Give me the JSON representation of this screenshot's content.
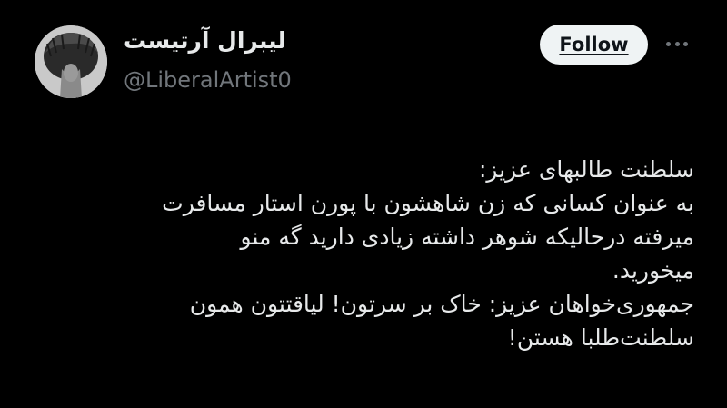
{
  "author": {
    "display_name": "لیبرال آرتیست",
    "handle": "@LiberalArtist0",
    "avatar_icon": "profile-photo-avatar"
  },
  "actions": {
    "follow_label": "Follow",
    "more_icon": "more-horizontal-icon"
  },
  "tweet": {
    "lines": [
      "سلطنت طالبهای عزیز:",
      "به عنوان کسانی که زن شاهشون با پورن استار مسافرت",
      "میرفته درحالیکه شوهر داشته زیادی دارید گه منو",
      "میخورید.",
      "جمهوری‌خواهان عزیز: خاک بر سرتون! لیاقتتون همون",
      "سلطنت‌طلبا هستن!"
    ]
  },
  "colors": {
    "background": "#000000",
    "primary_text": "#e7e9ea",
    "secondary_text": "#71767b",
    "follow_bg": "#eff3f4",
    "follow_text": "#0f1419"
  }
}
